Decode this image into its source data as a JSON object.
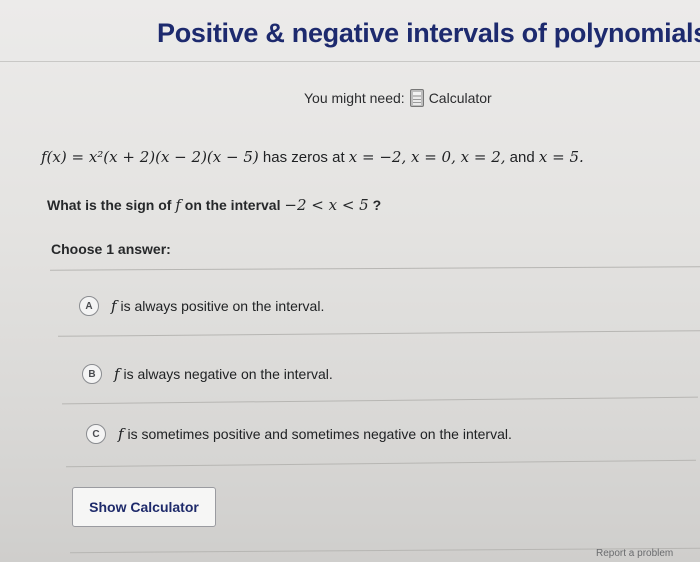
{
  "header": {
    "title": "Positive & negative intervals of polynomials"
  },
  "tools": {
    "might_need_label": "You might need:",
    "calculator_label": "Calculator"
  },
  "problem": {
    "function_expr": "f(x) = x²(x + 2)(x − 2)(x − 5)",
    "zeros_text": " has zeros at ",
    "zeros_expr": "x = −2, x = 0, x = 2,",
    "and_text": " and ",
    "last_zero": "x = 5.",
    "question_prefix": "What is the sign of ",
    "question_f": "f",
    "question_mid": " on the interval ",
    "question_interval": "−2 < x < 5",
    "question_suffix": " ?"
  },
  "answers": {
    "choose_label": "Choose 1 answer:",
    "options": [
      {
        "letter": "A",
        "f": "f",
        "text": " is always positive on the interval."
      },
      {
        "letter": "B",
        "f": "f",
        "text": " is always negative on the interval."
      },
      {
        "letter": "C",
        "f": "f",
        "text": " is sometimes positive and sometimes negative on the interval."
      }
    ]
  },
  "footer": {
    "show_calculator_label": "Show Calculator",
    "report_label": "Report a problem"
  }
}
